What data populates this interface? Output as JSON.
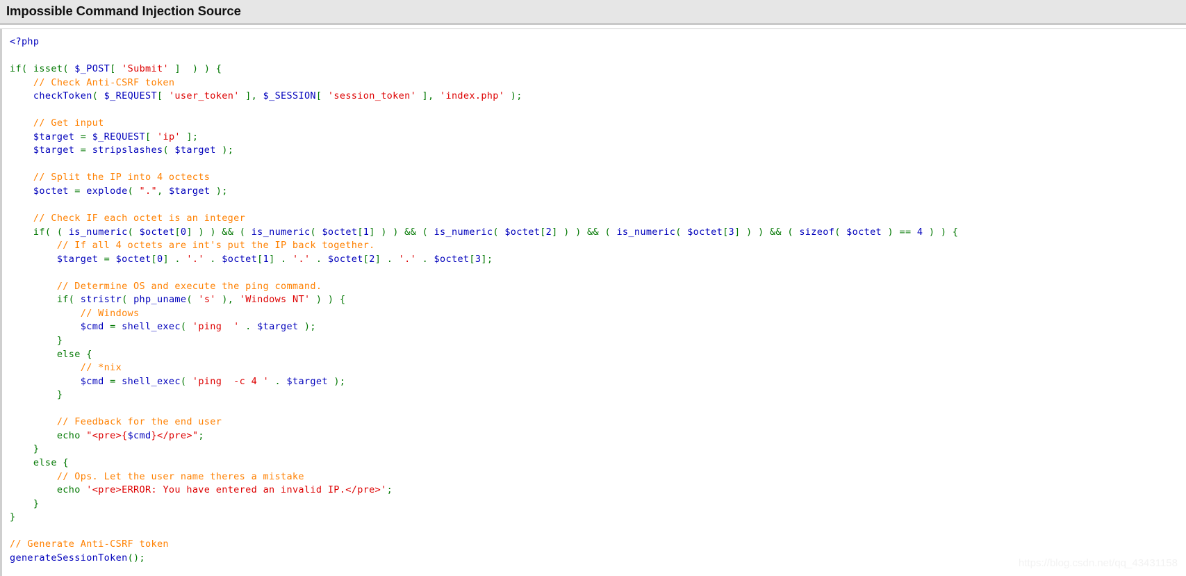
{
  "header": {
    "title": "Impossible Command Injection Source"
  },
  "watermark": {
    "text": "https://blog.csdn.net/qq_43431158"
  },
  "colors": {
    "header_background": "#e6e6e6",
    "header_rule": "#c8c8c8",
    "panel_background": "#ffffff",
    "panel_border": "#cfcfcf",
    "token_php_tag": "#0000bb",
    "token_keyword": "#007700",
    "token_function": "#0000bb",
    "token_variable": "#0000bb",
    "token_string": "#dd0000",
    "token_comment": "#ff8000",
    "token_operator": "#007700",
    "watermark": "#f2f2f2"
  },
  "code": {
    "language": "php",
    "raw": "<?php\n\nif( isset( $_POST[ 'Submit' ]  ) ) {\n    // Check Anti-CSRF token\n    checkToken( $_REQUEST[ 'user_token' ], $_SESSION[ 'session_token' ], 'index.php' );\n\n    // Get input\n    $target = $_REQUEST[ 'ip' ];\n    $target = stripslashes( $target );\n\n    // Split the IP into 4 octects\n    $octet = explode( \".\", $target );\n\n    // Check IF each octet is an integer\n    if( ( is_numeric( $octet[0] ) ) && ( is_numeric( $octet[1] ) ) && ( is_numeric( $octet[2] ) ) && ( is_numeric( $octet[3] ) ) && ( sizeof( $octet ) == 4 ) ) {\n        // If all 4 octets are int's put the IP back together.\n        $target = $octet[0] . '.' . $octet[1] . '.' . $octet[2] . '.' . $octet[3];\n\n        // Determine OS and execute the ping command.\n        if( stristr( php_uname( 's' ), 'Windows NT' ) ) {\n            // Windows\n            $cmd = shell_exec( 'ping  ' . $target );\n        }\n        else {\n            // *nix\n            $cmd = shell_exec( 'ping  -c 4 ' . $target );\n        }\n\n        // Feedback for the end user\n        echo \"<pre>{$cmd}</pre>\";\n    }\n    else {\n        // Ops. Let the user name theres a mistake\n        echo '<pre>ERROR: You have entered an invalid IP.</pre>';\n    }\n}\n\n// Generate Anti-CSRF token\ngenerateSessionToken();",
    "lines": [
      {
        "n": 1,
        "text": "<?php"
      },
      {
        "n": 2,
        "text": ""
      },
      {
        "n": 3,
        "text": "if( isset( $_POST[ 'Submit' ]  ) ) {"
      },
      {
        "n": 4,
        "text": "    // Check Anti-CSRF token"
      },
      {
        "n": 5,
        "text": "    checkToken( $_REQUEST[ 'user_token' ], $_SESSION[ 'session_token' ], 'index.php' );"
      },
      {
        "n": 6,
        "text": ""
      },
      {
        "n": 7,
        "text": "    // Get input"
      },
      {
        "n": 8,
        "text": "    $target = $_REQUEST[ 'ip' ];"
      },
      {
        "n": 9,
        "text": "    $target = stripslashes( $target );"
      },
      {
        "n": 10,
        "text": ""
      },
      {
        "n": 11,
        "text": "    // Split the IP into 4 octects"
      },
      {
        "n": 12,
        "text": "    $octet = explode( \".\", $target );"
      },
      {
        "n": 13,
        "text": ""
      },
      {
        "n": 14,
        "text": "    // Check IF each octet is an integer"
      },
      {
        "n": 15,
        "text": "    if( ( is_numeric( $octet[0] ) ) && ( is_numeric( $octet[1] ) ) && ( is_numeric( $octet[2] ) ) && ( is_numeric( $octet[3] ) ) && ( sizeof( $octet ) == 4 ) ) {"
      },
      {
        "n": 16,
        "text": "        // If all 4 octets are int's put the IP back together."
      },
      {
        "n": 17,
        "text": "        $target = $octet[0] . '.' . $octet[1] . '.' . $octet[2] . '.' . $octet[3];"
      },
      {
        "n": 18,
        "text": ""
      },
      {
        "n": 19,
        "text": "        // Determine OS and execute the ping command."
      },
      {
        "n": 20,
        "text": "        if( stristr( php_uname( 's' ), 'Windows NT' ) ) {"
      },
      {
        "n": 21,
        "text": "            // Windows"
      },
      {
        "n": 22,
        "text": "            $cmd = shell_exec( 'ping  ' . $target );"
      },
      {
        "n": 23,
        "text": "        }"
      },
      {
        "n": 24,
        "text": "        else {"
      },
      {
        "n": 25,
        "text": "            // *nix"
      },
      {
        "n": 26,
        "text": "            $cmd = shell_exec( 'ping  -c 4 ' . $target );"
      },
      {
        "n": 27,
        "text": "        }"
      },
      {
        "n": 28,
        "text": ""
      },
      {
        "n": 29,
        "text": "        // Feedback for the end user"
      },
      {
        "n": 30,
        "text": "        echo \"<pre>{$cmd}</pre>\";"
      },
      {
        "n": 31,
        "text": "    }"
      },
      {
        "n": 32,
        "text": "    else {"
      },
      {
        "n": 33,
        "text": "        // Ops. Let the user name theres a mistake"
      },
      {
        "n": 34,
        "text": "        echo '<pre>ERROR: You have entered an invalid IP.</pre>';"
      },
      {
        "n": 35,
        "text": "    }"
      },
      {
        "n": 36,
        "text": "}"
      },
      {
        "n": 37,
        "text": ""
      },
      {
        "n": 38,
        "text": "// Generate Anti-CSRF token"
      },
      {
        "n": 39,
        "text": "generateSessionToken();"
      }
    ],
    "tokens": [
      [
        {
          "t": "<?php",
          "c": "t-php"
        }
      ],
      [],
      [
        {
          "t": "if",
          "c": "t-kw"
        },
        {
          "t": "( ",
          "c": "t-op"
        },
        {
          "t": "isset",
          "c": "t-kw"
        },
        {
          "t": "( ",
          "c": "t-op"
        },
        {
          "t": "$_POST",
          "c": "t-var"
        },
        {
          "t": "[ ",
          "c": "t-op"
        },
        {
          "t": "'Submit'",
          "c": "t-str"
        },
        {
          "t": " ]  ) ) {",
          "c": "t-op"
        }
      ],
      [
        {
          "t": "    // Check Anti-CSRF token",
          "c": "t-cmt"
        }
      ],
      [
        {
          "t": "    ",
          "c": "t-plain"
        },
        {
          "t": "checkToken",
          "c": "t-fn"
        },
        {
          "t": "( ",
          "c": "t-op"
        },
        {
          "t": "$_REQUEST",
          "c": "t-var"
        },
        {
          "t": "[ ",
          "c": "t-op"
        },
        {
          "t": "'user_token'",
          "c": "t-str"
        },
        {
          "t": " ], ",
          "c": "t-op"
        },
        {
          "t": "$_SESSION",
          "c": "t-var"
        },
        {
          "t": "[ ",
          "c": "t-op"
        },
        {
          "t": "'session_token'",
          "c": "t-str"
        },
        {
          "t": " ], ",
          "c": "t-op"
        },
        {
          "t": "'index.php'",
          "c": "t-str"
        },
        {
          "t": " );",
          "c": "t-op"
        }
      ],
      [],
      [
        {
          "t": "    // Get input",
          "c": "t-cmt"
        }
      ],
      [
        {
          "t": "    ",
          "c": "t-plain"
        },
        {
          "t": "$target",
          "c": "t-var"
        },
        {
          "t": " = ",
          "c": "t-op"
        },
        {
          "t": "$_REQUEST",
          "c": "t-var"
        },
        {
          "t": "[ ",
          "c": "t-op"
        },
        {
          "t": "'ip'",
          "c": "t-str"
        },
        {
          "t": " ];",
          "c": "t-op"
        }
      ],
      [
        {
          "t": "    ",
          "c": "t-plain"
        },
        {
          "t": "$target",
          "c": "t-var"
        },
        {
          "t": " = ",
          "c": "t-op"
        },
        {
          "t": "stripslashes",
          "c": "t-fn"
        },
        {
          "t": "( ",
          "c": "t-op"
        },
        {
          "t": "$target",
          "c": "t-var"
        },
        {
          "t": " );",
          "c": "t-op"
        }
      ],
      [],
      [
        {
          "t": "    // Split the IP into 4 octects",
          "c": "t-cmt"
        }
      ],
      [
        {
          "t": "    ",
          "c": "t-plain"
        },
        {
          "t": "$octet",
          "c": "t-var"
        },
        {
          "t": " = ",
          "c": "t-op"
        },
        {
          "t": "explode",
          "c": "t-fn"
        },
        {
          "t": "( ",
          "c": "t-op"
        },
        {
          "t": "\".\"",
          "c": "t-str"
        },
        {
          "t": ", ",
          "c": "t-op"
        },
        {
          "t": "$target",
          "c": "t-var"
        },
        {
          "t": " );",
          "c": "t-op"
        }
      ],
      [],
      [
        {
          "t": "    // Check IF each octet is an integer",
          "c": "t-cmt"
        }
      ],
      [
        {
          "t": "    ",
          "c": "t-plain"
        },
        {
          "t": "if",
          "c": "t-kw"
        },
        {
          "t": "( ( ",
          "c": "t-op"
        },
        {
          "t": "is_numeric",
          "c": "t-fn"
        },
        {
          "t": "( ",
          "c": "t-op"
        },
        {
          "t": "$octet",
          "c": "t-var"
        },
        {
          "t": "[",
          "c": "t-op"
        },
        {
          "t": "0",
          "c": "t-num"
        },
        {
          "t": "] ) ) ",
          "c": "t-op"
        },
        {
          "t": "&&",
          "c": "t-op"
        },
        {
          "t": " ( ",
          "c": "t-op"
        },
        {
          "t": "is_numeric",
          "c": "t-fn"
        },
        {
          "t": "( ",
          "c": "t-op"
        },
        {
          "t": "$octet",
          "c": "t-var"
        },
        {
          "t": "[",
          "c": "t-op"
        },
        {
          "t": "1",
          "c": "t-num"
        },
        {
          "t": "] ) ) ",
          "c": "t-op"
        },
        {
          "t": "&&",
          "c": "t-op"
        },
        {
          "t": " ( ",
          "c": "t-op"
        },
        {
          "t": "is_numeric",
          "c": "t-fn"
        },
        {
          "t": "( ",
          "c": "t-op"
        },
        {
          "t": "$octet",
          "c": "t-var"
        },
        {
          "t": "[",
          "c": "t-op"
        },
        {
          "t": "2",
          "c": "t-num"
        },
        {
          "t": "] ) ) ",
          "c": "t-op"
        },
        {
          "t": "&&",
          "c": "t-op"
        },
        {
          "t": " ( ",
          "c": "t-op"
        },
        {
          "t": "is_numeric",
          "c": "t-fn"
        },
        {
          "t": "( ",
          "c": "t-op"
        },
        {
          "t": "$octet",
          "c": "t-var"
        },
        {
          "t": "[",
          "c": "t-op"
        },
        {
          "t": "3",
          "c": "t-num"
        },
        {
          "t": "] ) ) ",
          "c": "t-op"
        },
        {
          "t": "&&",
          "c": "t-op"
        },
        {
          "t": " ( ",
          "c": "t-op"
        },
        {
          "t": "sizeof",
          "c": "t-fn"
        },
        {
          "t": "( ",
          "c": "t-op"
        },
        {
          "t": "$octet",
          "c": "t-var"
        },
        {
          "t": " ) ",
          "c": "t-op"
        },
        {
          "t": "==",
          "c": "t-op"
        },
        {
          "t": " ",
          "c": "t-plain"
        },
        {
          "t": "4",
          "c": "t-num"
        },
        {
          "t": " ) ) {",
          "c": "t-op"
        }
      ],
      [
        {
          "t": "        // If all 4 octets are int's put the IP back together.",
          "c": "t-cmt"
        }
      ],
      [
        {
          "t": "        ",
          "c": "t-plain"
        },
        {
          "t": "$target",
          "c": "t-var"
        },
        {
          "t": " = ",
          "c": "t-op"
        },
        {
          "t": "$octet",
          "c": "t-var"
        },
        {
          "t": "[",
          "c": "t-op"
        },
        {
          "t": "0",
          "c": "t-num"
        },
        {
          "t": "] . ",
          "c": "t-op"
        },
        {
          "t": "'.'",
          "c": "t-str"
        },
        {
          "t": " . ",
          "c": "t-op"
        },
        {
          "t": "$octet",
          "c": "t-var"
        },
        {
          "t": "[",
          "c": "t-op"
        },
        {
          "t": "1",
          "c": "t-num"
        },
        {
          "t": "] . ",
          "c": "t-op"
        },
        {
          "t": "'.'",
          "c": "t-str"
        },
        {
          "t": " . ",
          "c": "t-op"
        },
        {
          "t": "$octet",
          "c": "t-var"
        },
        {
          "t": "[",
          "c": "t-op"
        },
        {
          "t": "2",
          "c": "t-num"
        },
        {
          "t": "] . ",
          "c": "t-op"
        },
        {
          "t": "'.'",
          "c": "t-str"
        },
        {
          "t": " . ",
          "c": "t-op"
        },
        {
          "t": "$octet",
          "c": "t-var"
        },
        {
          "t": "[",
          "c": "t-op"
        },
        {
          "t": "3",
          "c": "t-num"
        },
        {
          "t": "];",
          "c": "t-op"
        }
      ],
      [],
      [
        {
          "t": "        // Determine OS and execute the ping command.",
          "c": "t-cmt"
        }
      ],
      [
        {
          "t": "        ",
          "c": "t-plain"
        },
        {
          "t": "if",
          "c": "t-kw"
        },
        {
          "t": "( ",
          "c": "t-op"
        },
        {
          "t": "stristr",
          "c": "t-fn"
        },
        {
          "t": "( ",
          "c": "t-op"
        },
        {
          "t": "php_uname",
          "c": "t-fn"
        },
        {
          "t": "( ",
          "c": "t-op"
        },
        {
          "t": "'s'",
          "c": "t-str"
        },
        {
          "t": " ), ",
          "c": "t-op"
        },
        {
          "t": "'Windows NT'",
          "c": "t-str"
        },
        {
          "t": " ) ) {",
          "c": "t-op"
        }
      ],
      [
        {
          "t": "            // Windows",
          "c": "t-cmt"
        }
      ],
      [
        {
          "t": "            ",
          "c": "t-plain"
        },
        {
          "t": "$cmd",
          "c": "t-var"
        },
        {
          "t": " = ",
          "c": "t-op"
        },
        {
          "t": "shell_exec",
          "c": "t-fn"
        },
        {
          "t": "( ",
          "c": "t-op"
        },
        {
          "t": "'ping  '",
          "c": "t-str"
        },
        {
          "t": " . ",
          "c": "t-op"
        },
        {
          "t": "$target",
          "c": "t-var"
        },
        {
          "t": " );",
          "c": "t-op"
        }
      ],
      [
        {
          "t": "        }",
          "c": "t-op"
        }
      ],
      [
        {
          "t": "        ",
          "c": "t-plain"
        },
        {
          "t": "else",
          "c": "t-kw"
        },
        {
          "t": " {",
          "c": "t-op"
        }
      ],
      [
        {
          "t": "            // *nix",
          "c": "t-cmt"
        }
      ],
      [
        {
          "t": "            ",
          "c": "t-plain"
        },
        {
          "t": "$cmd",
          "c": "t-var"
        },
        {
          "t": " = ",
          "c": "t-op"
        },
        {
          "t": "shell_exec",
          "c": "t-fn"
        },
        {
          "t": "( ",
          "c": "t-op"
        },
        {
          "t": "'ping  -c 4 '",
          "c": "t-str"
        },
        {
          "t": " . ",
          "c": "t-op"
        },
        {
          "t": "$target",
          "c": "t-var"
        },
        {
          "t": " );",
          "c": "t-op"
        }
      ],
      [
        {
          "t": "        }",
          "c": "t-op"
        }
      ],
      [],
      [
        {
          "t": "        // Feedback for the end user",
          "c": "t-cmt"
        }
      ],
      [
        {
          "t": "        ",
          "c": "t-plain"
        },
        {
          "t": "echo",
          "c": "t-kw"
        },
        {
          "t": " ",
          "c": "t-plain"
        },
        {
          "t": "\"<pre>{",
          "c": "t-str"
        },
        {
          "t": "$cmd",
          "c": "t-var"
        },
        {
          "t": "}</pre>\"",
          "c": "t-str"
        },
        {
          "t": ";",
          "c": "t-op"
        }
      ],
      [
        {
          "t": "    }",
          "c": "t-op"
        }
      ],
      [
        {
          "t": "    ",
          "c": "t-plain"
        },
        {
          "t": "else",
          "c": "t-kw"
        },
        {
          "t": " {",
          "c": "t-op"
        }
      ],
      [
        {
          "t": "        // Ops. Let the user name theres a mistake",
          "c": "t-cmt"
        }
      ],
      [
        {
          "t": "        ",
          "c": "t-plain"
        },
        {
          "t": "echo",
          "c": "t-kw"
        },
        {
          "t": " ",
          "c": "t-plain"
        },
        {
          "t": "'<pre>ERROR: You have entered an invalid IP.</pre>'",
          "c": "t-str"
        },
        {
          "t": ";",
          "c": "t-op"
        }
      ],
      [
        {
          "t": "    }",
          "c": "t-op"
        }
      ],
      [
        {
          "t": "}",
          "c": "t-op"
        }
      ],
      [],
      [
        {
          "t": "// Generate Anti-CSRF token",
          "c": "t-cmt"
        }
      ],
      [
        {
          "t": "generateSessionToken",
          "c": "t-fn"
        },
        {
          "t": "()",
          "c": "t-op"
        },
        {
          "t": ";",
          "c": "t-op"
        }
      ]
    ]
  }
}
